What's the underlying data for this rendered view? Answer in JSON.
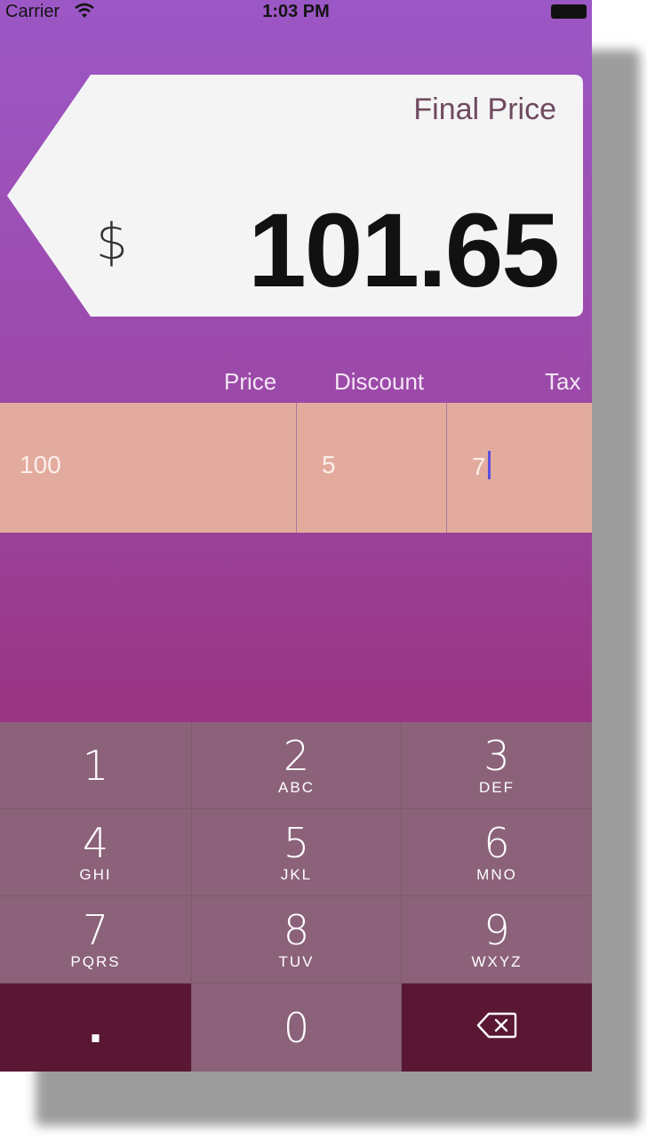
{
  "status_bar": {
    "carrier": "Carrier",
    "time": "1:03 PM"
  },
  "price_tag": {
    "label": "Final Price",
    "currency_symbol": "$",
    "amount": "101.65"
  },
  "fields": {
    "price": {
      "label": "Price",
      "value": "100"
    },
    "discount": {
      "label": "Discount",
      "value": "5"
    },
    "tax": {
      "label": "Tax",
      "value": "7"
    }
  },
  "keypad": {
    "keys": [
      {
        "digit": "1",
        "letters": ""
      },
      {
        "digit": "2",
        "letters": "ABC"
      },
      {
        "digit": "3",
        "letters": "DEF"
      },
      {
        "digit": "4",
        "letters": "GHI"
      },
      {
        "digit": "5",
        "letters": "JKL"
      },
      {
        "digit": "6",
        "letters": "MNO"
      },
      {
        "digit": "7",
        "letters": "PQRS"
      },
      {
        "digit": "8",
        "letters": "TUV"
      },
      {
        "digit": "9",
        "letters": "WXYZ"
      }
    ],
    "decimal": ".",
    "zero": "0"
  },
  "colors": {
    "background_top": "#9c57c6",
    "background_bottom": "#8f2d6a",
    "input_row": "#e3ab9e",
    "key_light": "#8b6279",
    "key_dark": "#5a1734"
  }
}
